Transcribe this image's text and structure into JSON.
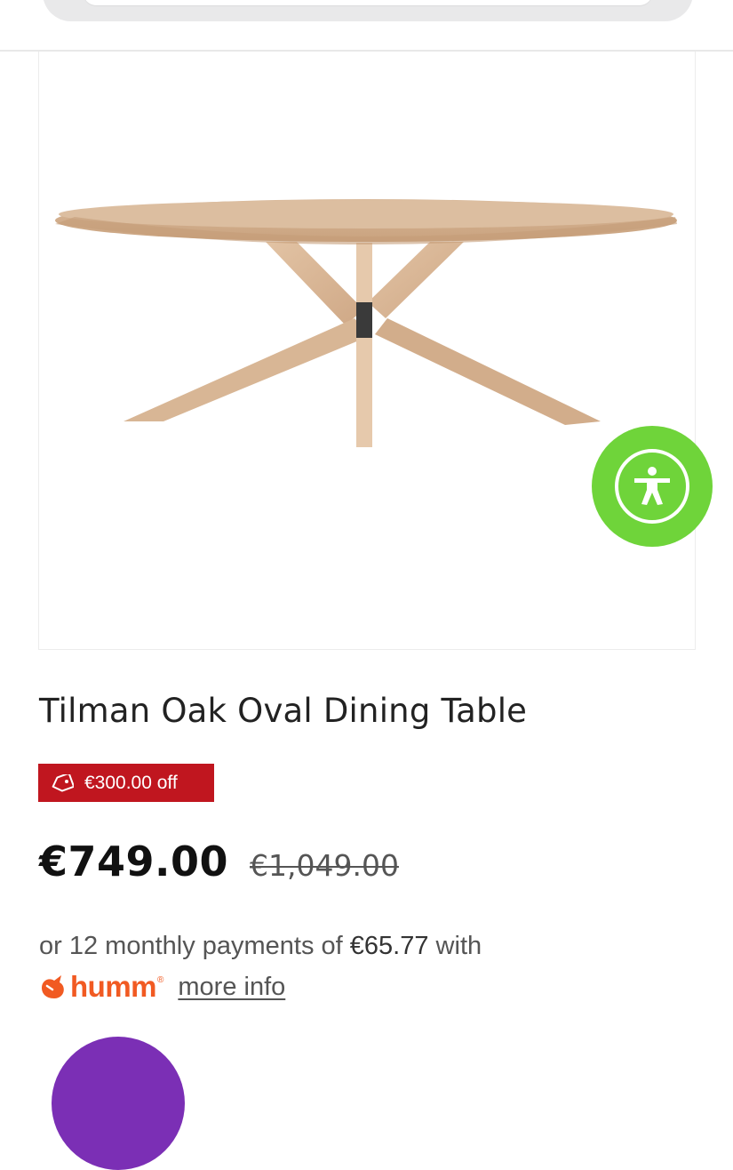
{
  "product": {
    "title": "Tilman Oak Oval Dining Table",
    "discount_label": "€300.00 off",
    "price_current": "€749.00",
    "price_original": "€1,049.00"
  },
  "financing": {
    "text_prefix": "or 12 monthly payments of ",
    "amount": "€65.77",
    "text_suffix": " with",
    "provider_name": "humm",
    "more_info_label": "more info"
  },
  "icons": {
    "discount_tag": "tag-icon",
    "accessibility": "accessibility-icon",
    "provider_logo": "humm-logo-icon"
  },
  "colors": {
    "badge": "#c0161f",
    "accessibility_button": "#6fd43a",
    "humm_brand": "#f15a22",
    "bottom_button": "#7b2fb5"
  }
}
